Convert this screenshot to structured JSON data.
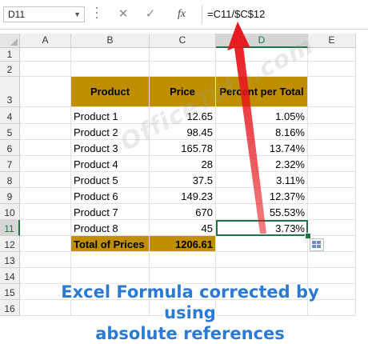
{
  "formula_bar": {
    "name_box": "D11",
    "cancel_symbol": "✕",
    "enter_symbol": "✓",
    "fx_symbol": "fx",
    "formula": "=C11/$C$12"
  },
  "columns": [
    "A",
    "B",
    "C",
    "D",
    "E"
  ],
  "selected_column": "D",
  "rows": [
    "1",
    "2",
    "3",
    "4",
    "5",
    "6",
    "7",
    "8",
    "9",
    "10",
    "11",
    "12",
    "13",
    "14",
    "15",
    "16"
  ],
  "selected_row": "11",
  "table": {
    "headers": [
      "Product",
      "Price",
      "Percent per Total"
    ],
    "rows": [
      [
        "Product 1",
        "12.65",
        "1.05%"
      ],
      [
        "Product 2",
        "98.45",
        "8.16%"
      ],
      [
        "Product 3",
        "165.78",
        "13.74%"
      ],
      [
        "Product 4",
        "28",
        "2.32%"
      ],
      [
        "Product 5",
        "37.5",
        "3.11%"
      ],
      [
        "Product 6",
        "149.23",
        "12.37%"
      ],
      [
        "Product 7",
        "670",
        "55.53%"
      ],
      [
        "Product 8",
        "45",
        "3.73%"
      ]
    ],
    "total_label": "Total of Prices",
    "total_value": "1206.61"
  },
  "watermark": "OfficeTuto.com",
  "caption": {
    "line1": "Excel Formula corrected by using",
    "line2": "absolute references"
  },
  "colors": {
    "header_fill": "#bf8f00",
    "selection": "#217346",
    "arrow": "#e8141b",
    "caption": "#2a7ad6"
  }
}
